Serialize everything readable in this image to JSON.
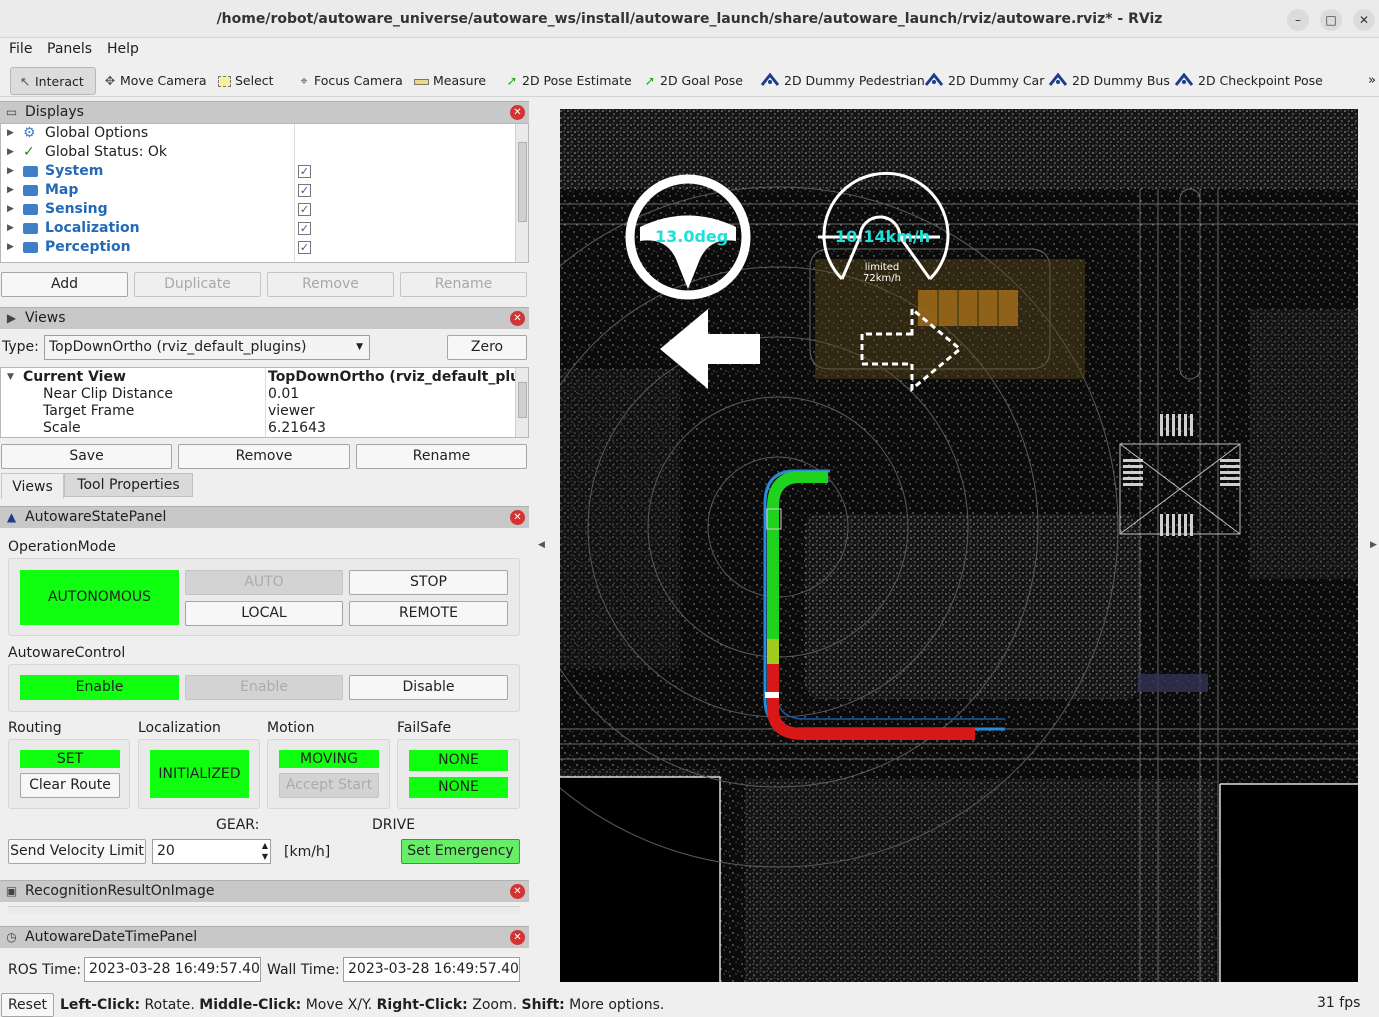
{
  "window": {
    "title": "/home/robot/autoware_universe/autoware_ws/install/autoware_launch/share/autoware_launch/rviz/autoware.rviz* - RViz"
  },
  "menu": [
    "File",
    "Panels",
    "Help"
  ],
  "toolbar": {
    "interact": "Interact",
    "move_camera": "Move Camera",
    "select": "Select",
    "focus_camera": "Focus Camera",
    "measure": "Measure",
    "pose_estimate": "2D Pose Estimate",
    "goal_pose": "2D Goal Pose",
    "dummy_pedestrian": "2D Dummy Pedestrian",
    "dummy_car": "2D Dummy Car",
    "dummy_bus": "2D Dummy Bus",
    "checkpoint_pose": "2D Checkpoint Pose",
    "more": "»"
  },
  "displays": {
    "title": "Displays",
    "items": [
      {
        "label": "Global Options"
      },
      {
        "label": "Global Status: Ok"
      },
      {
        "label": "System",
        "checked": true
      },
      {
        "label": "Map",
        "checked": true
      },
      {
        "label": "Sensing",
        "checked": true
      },
      {
        "label": "Localization",
        "checked": true
      },
      {
        "label": "Perception",
        "checked": true
      }
    ],
    "buttons": {
      "add": "Add",
      "duplicate": "Duplicate",
      "remove": "Remove",
      "rename": "Rename"
    }
  },
  "views": {
    "title": "Views",
    "type_label": "Type:",
    "type_value": "TopDownOrtho (rviz_default_plugins)",
    "zero": "Zero",
    "current_view_label": "Current View",
    "current_view_value": "TopDownOrtho (rviz_default_plu...",
    "props": [
      {
        "name": "Near Clip Distance",
        "value": "0.01"
      },
      {
        "name": "Target Frame",
        "value": "viewer"
      },
      {
        "name": "Scale",
        "value": "6.21643"
      }
    ],
    "buttons": {
      "save": "Save",
      "remove": "Remove",
      "rename": "Rename"
    },
    "tabs": {
      "views": "Views",
      "tool_properties": "Tool Properties"
    }
  },
  "state_panel": {
    "title": "AutowareStatePanel",
    "operation_mode_label": "OperationMode",
    "autonomous": "AUTONOMOUS",
    "auto": "AUTO",
    "stop": "STOP",
    "local": "LOCAL",
    "remote": "REMOTE",
    "control_label": "AutowareControl",
    "enable_active": "Enable",
    "enable": "Enable",
    "disable": "Disable",
    "routing_label": "Routing",
    "routing_state": "SET",
    "clear_route": "Clear Route",
    "localization_label": "Localization",
    "localization_state": "INITIALIZED",
    "motion_label": "Motion",
    "motion_state": "MOVING",
    "accept_start": "Accept Start",
    "failsafe_label": "FailSafe",
    "failsafe_1": "NONE",
    "failsafe_2": "NONE",
    "gear_label": "GEAR:",
    "gear_value": "DRIVE",
    "send_velocity": "Send Velocity Limit",
    "velocity_value": "20",
    "velocity_unit": "[km/h]",
    "set_emergency": "Set Emergency"
  },
  "recognition_panel": {
    "title": "RecognitionResultOnImage"
  },
  "datetime_panel": {
    "title": "AutowareDateTimePanel",
    "ros_label": "ROS Time:",
    "ros_value": "2023-03-28 16:49:57.400",
    "wall_label": "Wall Time:",
    "wall_value": "2023-03-28 16:49:57.400"
  },
  "viewport": {
    "steering": "13.0deg",
    "speed": "10.14km/h",
    "limit_line1": "limited",
    "limit_line2": "72km/h"
  },
  "statusbar": {
    "reset": "Reset",
    "left_click_b": "Left-Click:",
    "left_click": " Rotate. ",
    "middle_click_b": "Middle-Click:",
    "middle_click": " Move X/Y. ",
    "right_click_b": "Right-Click:",
    "right_click": " Zoom. ",
    "shift_b": "Shift:",
    "shift": " More options.",
    "fps": "31 fps"
  },
  "colors": {
    "active_green": "#10ff10",
    "panel_header": "#c8c8c8",
    "close_red": "#d23434"
  }
}
